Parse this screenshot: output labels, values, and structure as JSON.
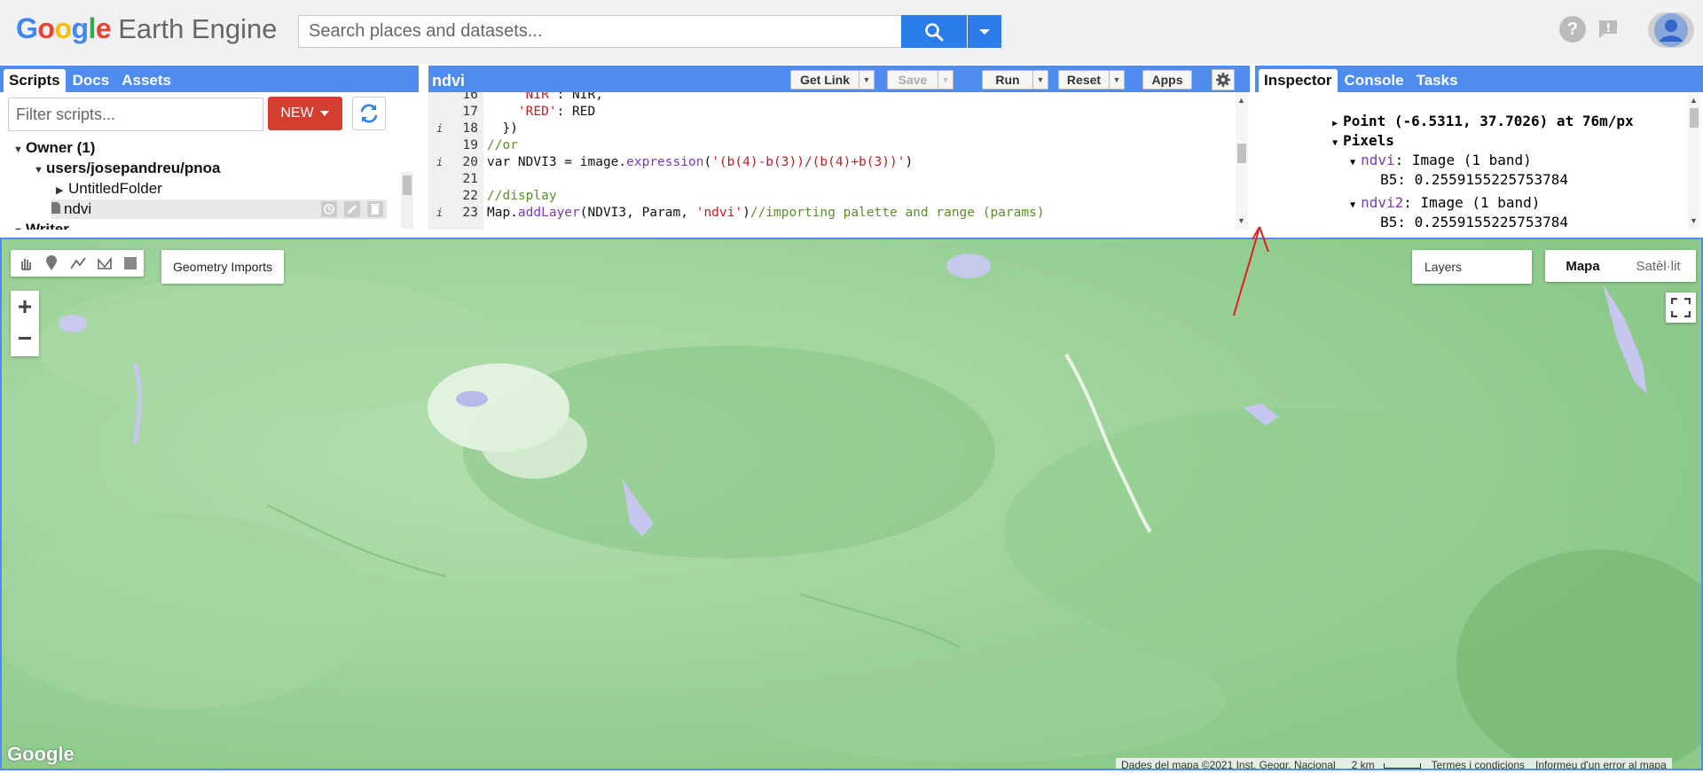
{
  "header": {
    "logo_google": [
      "G",
      "o",
      "o",
      "g",
      "l",
      "e"
    ],
    "logo_colors": [
      "#4285f4",
      "#ea4335",
      "#fbbc05",
      "#4285f4",
      "#34a853",
      "#ea4335"
    ],
    "logo_product": "Earth Engine",
    "search_placeholder": "Search places and datasets...",
    "accent": "#2b7de9",
    "icons": [
      "help-icon",
      "feedback-icon",
      "account-icon"
    ]
  },
  "left_panel": {
    "tabs": [
      "Scripts",
      "Docs",
      "Assets"
    ],
    "filter_placeholder": "Filter scripts...",
    "new_label": "NEW",
    "tree": [
      {
        "label": "Owner (1)",
        "level": 0,
        "expanded": true,
        "bold": true
      },
      {
        "label": "users/josepandreu/pnoa",
        "level": 1,
        "expanded": true,
        "bold": true
      },
      {
        "label": "UntitledFolder",
        "level": 2,
        "expanded": false,
        "bold": false
      },
      {
        "label": "ndvi",
        "level": 2,
        "file": true,
        "selected": true
      },
      {
        "label": "Writer",
        "level": 0,
        "expanded": true,
        "bold": true
      }
    ]
  },
  "editor": {
    "title": "ndvi",
    "buttons": {
      "get_link": "Get Link",
      "save": "Save",
      "run": "Run",
      "reset": "Reset",
      "apps": "Apps"
    },
    "lines": [
      {
        "n": "16",
        "info": false,
        "parts": [
          {
            "t": "    ",
            "c": ""
          },
          {
            "t": "'NIR'",
            "c": "c-str"
          },
          {
            "t": ": NIR,",
            "c": ""
          }
        ]
      },
      {
        "n": "17",
        "info": false,
        "parts": [
          {
            "t": "    ",
            "c": ""
          },
          {
            "t": "'RED'",
            "c": "c-str"
          },
          {
            "t": ": RED",
            "c": ""
          }
        ]
      },
      {
        "n": "18",
        "info": true,
        "parts": [
          {
            "t": "  })",
            "c": ""
          }
        ]
      },
      {
        "n": "19",
        "info": false,
        "parts": [
          {
            "t": "//or",
            "c": "c-cm"
          }
        ]
      },
      {
        "n": "20",
        "info": true,
        "parts": [
          {
            "t": "var NDVI3 = image.",
            "c": ""
          },
          {
            "t": "expression",
            "c": "c-fn"
          },
          {
            "t": "(",
            "c": ""
          },
          {
            "t": "'(b(4)-b(3))/(b(4)+b(3))'",
            "c": "c-str"
          },
          {
            "t": ")",
            "c": ""
          }
        ]
      },
      {
        "n": "21",
        "info": false,
        "parts": [
          {
            "t": "",
            "c": ""
          }
        ]
      },
      {
        "n": "22",
        "info": false,
        "parts": [
          {
            "t": "//display",
            "c": "c-cm"
          }
        ]
      },
      {
        "n": "23",
        "info": true,
        "parts": [
          {
            "t": "Map.",
            "c": ""
          },
          {
            "t": "addLayer",
            "c": "c-fn"
          },
          {
            "t": "(NDVI3, Param, ",
            "c": ""
          },
          {
            "t": "'ndvi'",
            "c": "c-str"
          },
          {
            "t": ")",
            "c": ""
          },
          {
            "t": "//importing palette and range (params)",
            "c": "c-cm"
          }
        ]
      }
    ]
  },
  "right_panel": {
    "tabs": [
      "Inspector",
      "Console",
      "Tasks"
    ],
    "point_label": "Point (-6.5311, 37.7026) at 76m/px",
    "pixels_label": "Pixels",
    "layers": [
      {
        "name": "ndvi",
        "desc": ": Image (1 band)",
        "band": "B5",
        "value": "0.2559155225753784"
      },
      {
        "name": "ndvi2",
        "desc": ": Image (1 band)",
        "band": "B5",
        "value": "0.2559155225753784"
      }
    ]
  },
  "map": {
    "geometry_imports": "Geometry Imports",
    "layers_label": "Layers",
    "map_type": [
      "Mapa",
      "Satèl·lit"
    ],
    "google_mark": "Google",
    "attribution": {
      "data": "Dades del mapa ©2021 Inst. Geogr. Nacional",
      "scale": "2 km",
      "terms": "Termes i condicions",
      "report": "Informeu d'un error al mapa"
    },
    "base_color": "#9ed49a",
    "arrow_color": "#e02020"
  }
}
